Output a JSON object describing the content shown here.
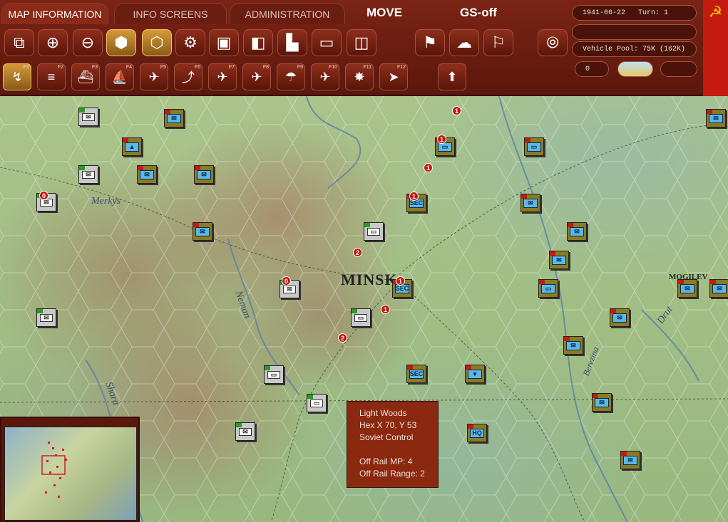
{
  "tabs": [
    {
      "label": "MAP INFORMATION",
      "active": true
    },
    {
      "label": "INFO SCREENS",
      "active": false
    },
    {
      "label": "ADMINISTRATION",
      "active": false
    }
  ],
  "mode": {
    "phase": "MOVE",
    "status": "GS-off"
  },
  "toolbar_row1": [
    {
      "icon": "windows-icon",
      "glyph": "⧉"
    },
    {
      "icon": "zoom-in-icon",
      "glyph": "⊕"
    },
    {
      "icon": "zoom-out-icon",
      "glyph": "⊖"
    },
    {
      "icon": "hex-grid-icon",
      "glyph": "⬢",
      "active": true
    },
    {
      "icon": "hex-outline-icon",
      "glyph": "⬡",
      "active": true
    },
    {
      "icon": "gear-icon",
      "glyph": "⚙"
    },
    {
      "icon": "unit-display-icon",
      "glyph": "▣"
    },
    {
      "icon": "stack-icon",
      "glyph": "◧"
    },
    {
      "icon": "factory-icon",
      "glyph": "▙"
    },
    {
      "icon": "rectangle-icon",
      "glyph": "▭"
    },
    {
      "icon": "supply-icon",
      "glyph": "◫"
    },
    {
      "icon": "flag-arrow-icon",
      "glyph": "⚑"
    },
    {
      "icon": "weather-icon",
      "glyph": "☁"
    },
    {
      "icon": "flag-outline-icon",
      "glyph": "⚐"
    },
    {
      "icon": "end-turn-icon",
      "glyph": "⦾"
    }
  ],
  "toolbar_row2": [
    {
      "icon": "move-icon",
      "key": "F1",
      "glyph": "↯",
      "active": true
    },
    {
      "icon": "rail-icon",
      "key": "F2",
      "glyph": "≡"
    },
    {
      "icon": "naval-icon",
      "key": "F3",
      "glyph": "⛴"
    },
    {
      "icon": "naval-transport-icon",
      "key": "F4",
      "glyph": "⛵"
    },
    {
      "icon": "air-recon-icon",
      "key": "F5",
      "glyph": "✈"
    },
    {
      "icon": "air-transfer-icon",
      "key": "F6",
      "glyph": "⤴"
    },
    {
      "icon": "air-bomb-icon",
      "key": "F7",
      "glyph": "✈"
    },
    {
      "icon": "air-attack-city-icon",
      "key": "F8",
      "glyph": "✈"
    },
    {
      "icon": "paradrop-icon",
      "key": "F9",
      "glyph": "☂"
    },
    {
      "icon": "air-strike-icon",
      "key": "F10",
      "glyph": "✈"
    },
    {
      "icon": "explosion-icon",
      "key": "F11",
      "glyph": "✸"
    },
    {
      "icon": "advance-icon",
      "key": "F12",
      "glyph": "➤"
    },
    {
      "icon": "upload-icon",
      "key": "",
      "glyph": "⬆"
    }
  ],
  "info": {
    "date": "1941-06-22",
    "turn": "Turn: 1",
    "line2": "",
    "vehicle_pool": "Vehicle Pool: 75K (162K)",
    "counter": "0"
  },
  "map": {
    "labels": [
      "Merkys",
      "Neman",
      "MINSK",
      "MOGILEV",
      "Drut",
      "Berezina",
      "Shara"
    ],
    "markers": [
      "1",
      "1",
      "1",
      "1",
      "1",
      "2",
      "1",
      "1",
      "2",
      "0",
      "0"
    ],
    "unit_labels": [
      "SEC",
      "SEC",
      "SEC",
      "HQ"
    ]
  },
  "tooltip": {
    "terrain": "Light Woods",
    "hex": "Hex X 70, Y 53",
    "control": "Soviet Control",
    "mp": "Off Rail MP: 4",
    "range": "Off Rail Range: 2"
  },
  "colors": {
    "bar": "#6a1d10",
    "accent": "#d49a3a",
    "soviet": "#c41a10"
  }
}
